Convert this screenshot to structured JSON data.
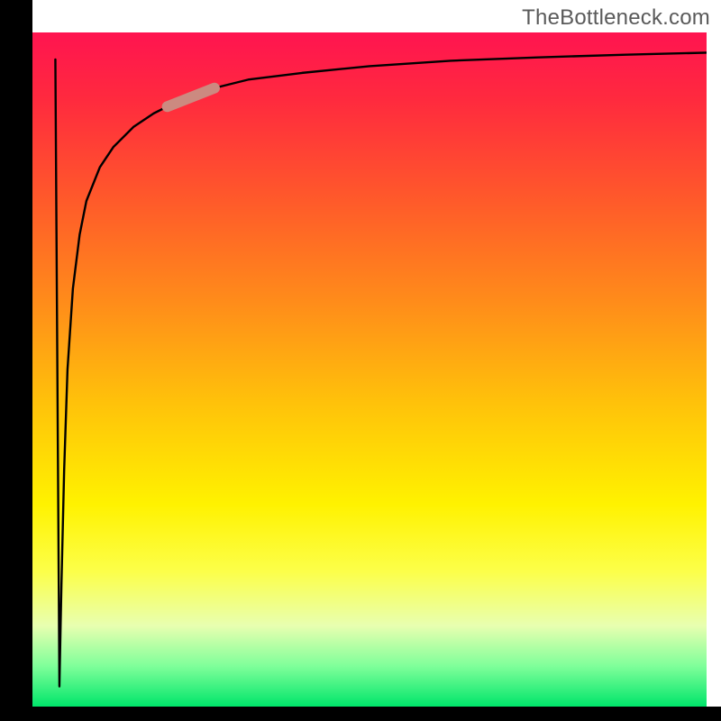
{
  "watermark": "TheBottleneck.com",
  "chart_data": {
    "type": "line",
    "title": "",
    "xlabel": "",
    "ylabel": "",
    "xlim": [
      0,
      100
    ],
    "ylim": [
      0,
      100
    ],
    "grid": false,
    "legend": false,
    "background_gradient": {
      "direction": "vertical",
      "stops": [
        {
          "pos": 0.0,
          "color": "#ff1450"
        },
        {
          "pos": 0.25,
          "color": "#ff5a2a"
        },
        {
          "pos": 0.55,
          "color": "#ffc20a"
        },
        {
          "pos": 0.8,
          "color": "#fcff4a"
        },
        {
          "pos": 1.0,
          "color": "#00e56a"
        }
      ]
    },
    "series": [
      {
        "name": "bottleneck-curve",
        "color": "#000000",
        "marker_segment": {
          "x_range": [
            20,
            27
          ],
          "color": "#cc8a80"
        },
        "x": [
          4,
          4.3,
          4.7,
          5.2,
          6,
          7,
          8,
          10,
          12,
          15,
          18,
          22,
          26,
          32,
          40,
          50,
          62,
          75,
          88,
          100
        ],
        "y": [
          3,
          18,
          35,
          50,
          62,
          70,
          75,
          80,
          83,
          86,
          88,
          90,
          91.5,
          93,
          94,
          95,
          95.8,
          96.3,
          96.7,
          97
        ]
      }
    ]
  }
}
